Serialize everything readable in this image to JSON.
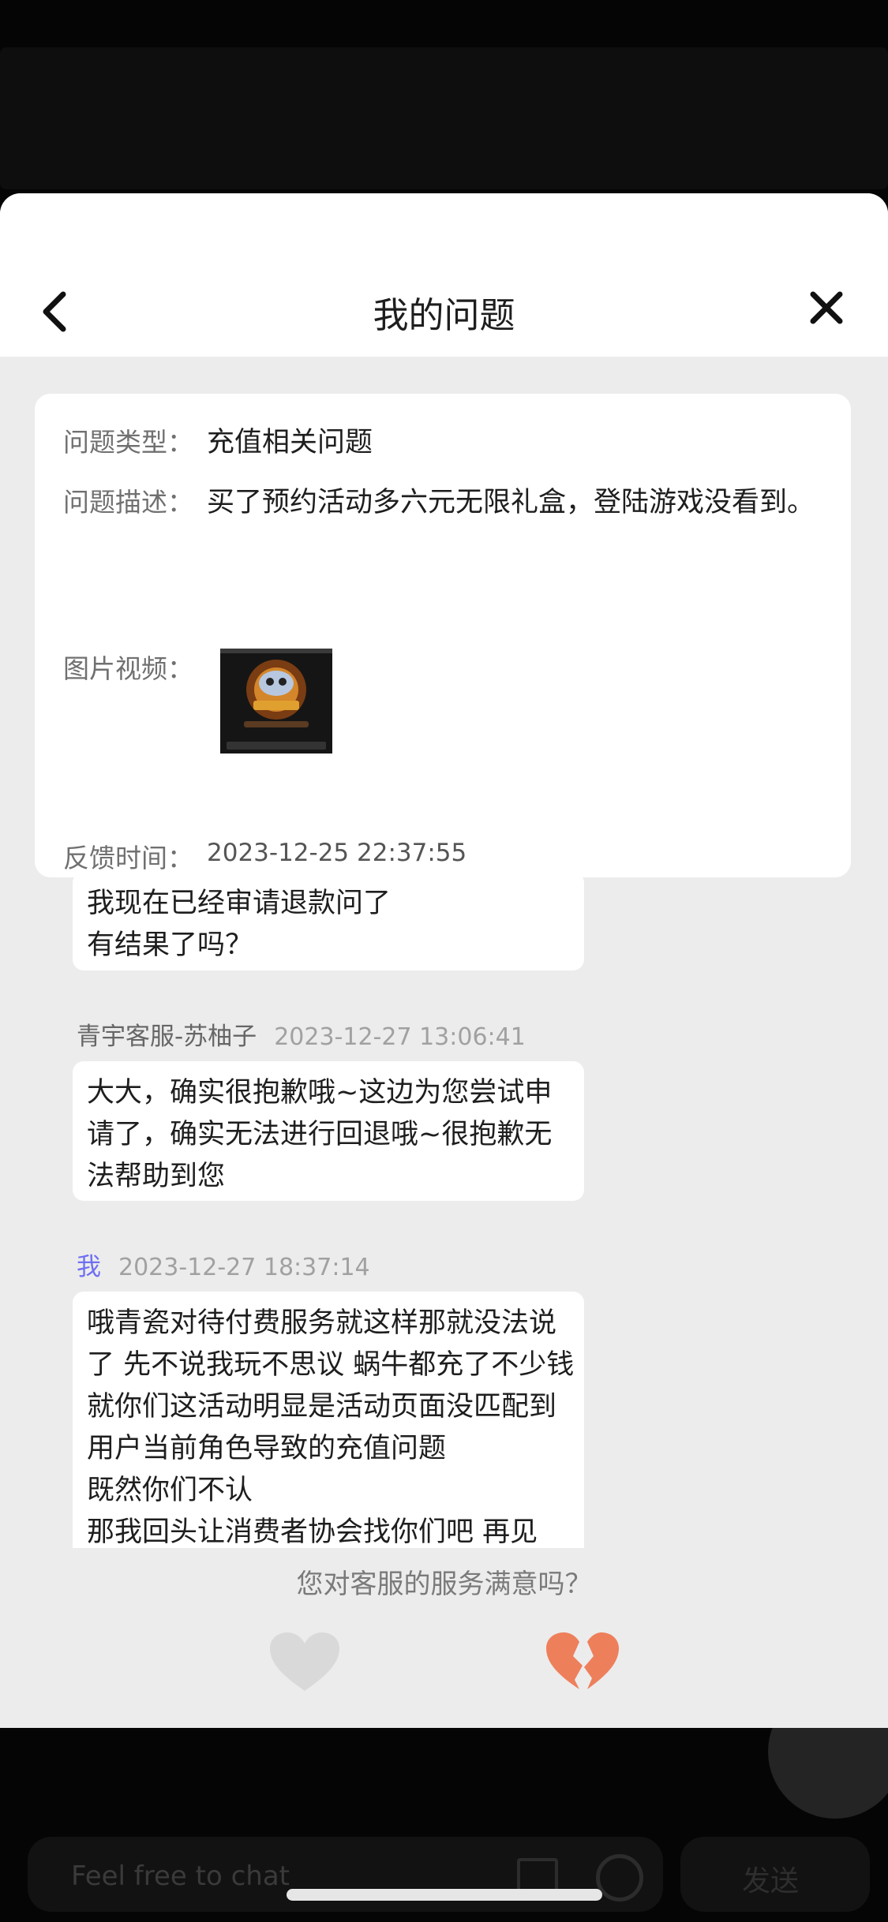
{
  "header": {
    "title": "我的问题"
  },
  "issue": {
    "type_label": "问题类型：",
    "type_value": "充值相关问题",
    "desc_label": "问题描述：",
    "desc_value": "买了预约活动多六元无限礼盒，登陆游戏没看到。",
    "media_label": "图片视频：",
    "time_label": "反馈时间：",
    "time_value": "2023-12-25 22:37:55"
  },
  "chat": [
    {
      "sender": "",
      "time": "",
      "lines": [
        "我现在已经审请退款问了",
        "有结果了吗？"
      ]
    },
    {
      "sender": "青宇客服-苏柚子",
      "time": "2023-12-27 13:06:41",
      "lines": [
        "大大，确实很抱歉哦~这边为您尝试申",
        "请了，确实无法进行回退哦~很抱歉无",
        "法帮助到您"
      ]
    },
    {
      "sender": "我",
      "time": "2023-12-27 18:37:14",
      "lines": [
        "哦青瓷对待付费服务就这样那就没法说",
        "了 先不说我玩不思议 蜗牛都充了不少钱",
        "就你们这活动明显是活动页面没匹配到",
        "用户当前角色导致的充值问题",
        "既然你们不认",
        "那我回头让消费者协会找你们吧 再见"
      ]
    }
  ],
  "rating": {
    "question": "您对客服的服务满意吗？"
  },
  "bottom": {
    "placeholder": "Feel free to chat",
    "send_label": "发送"
  },
  "colors": {
    "heart_liked": "#d9d9d9",
    "heart_broken": "#ee7f5b",
    "me_name": "#6f6ff2"
  }
}
